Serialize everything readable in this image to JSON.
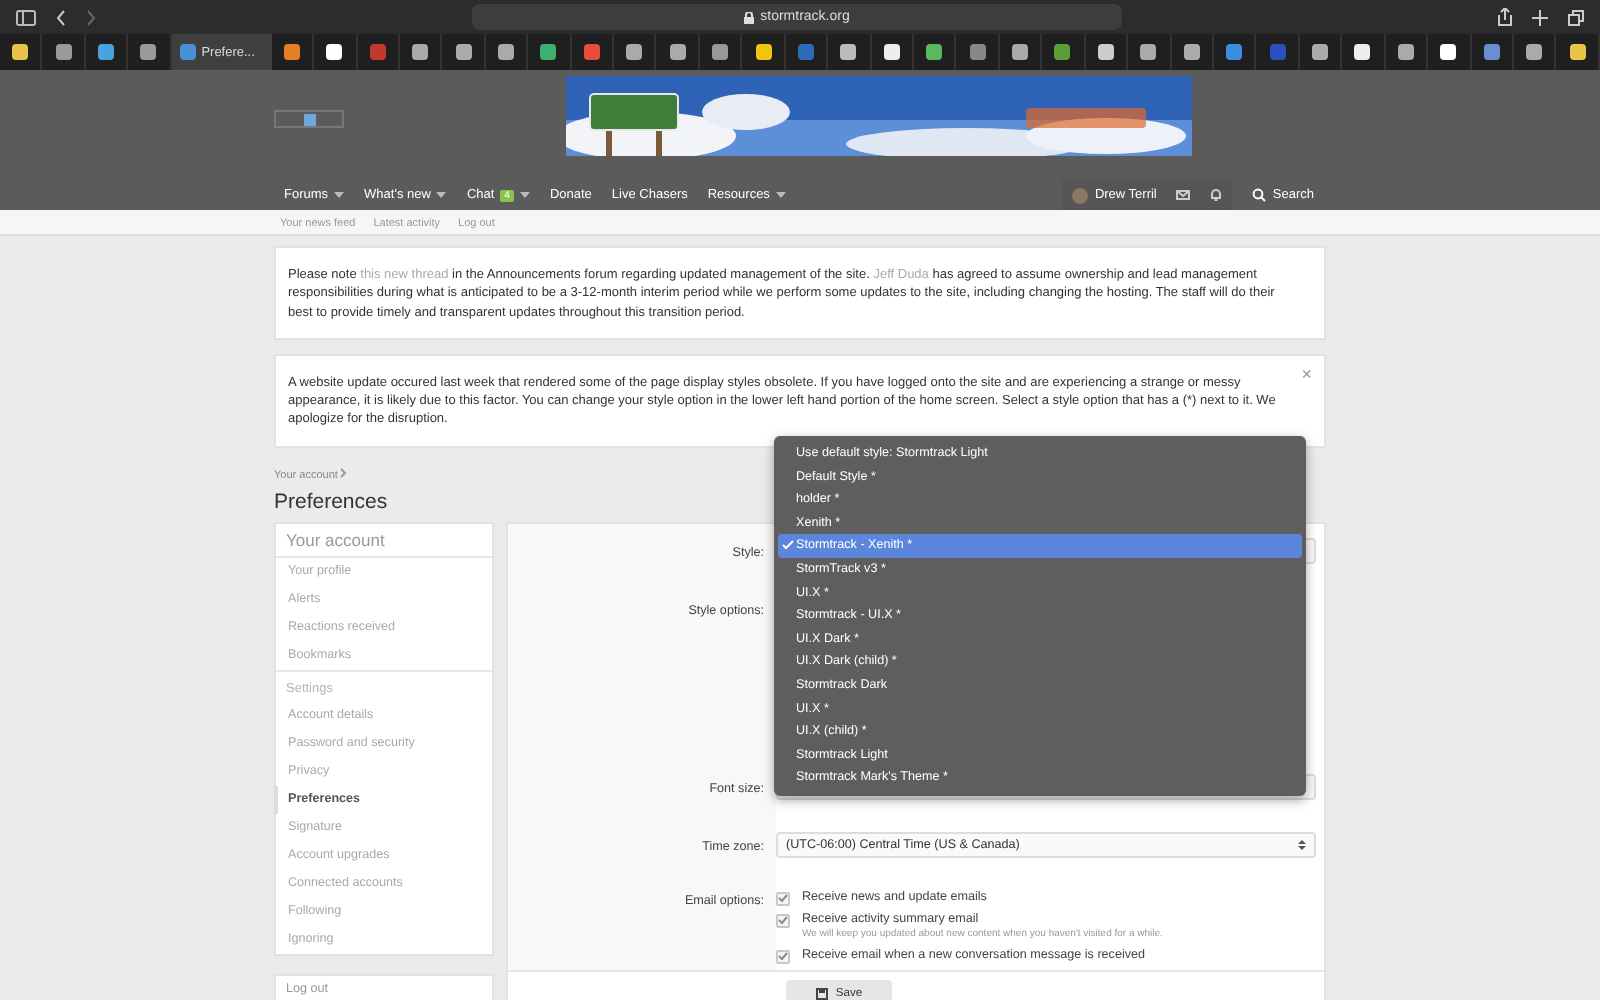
{
  "browser": {
    "url": "stormtrack.org",
    "tabs": [
      {
        "kind": "icon",
        "selected": false
      },
      {
        "kind": "icon",
        "selected": false
      },
      {
        "kind": "icon",
        "selected": false
      },
      {
        "kind": "icon",
        "selected": false
      },
      {
        "kind": "page",
        "label": "Prefere...",
        "selected": true
      },
      {
        "kind": "icon",
        "selected": false
      },
      {
        "kind": "icon",
        "selected": false
      },
      {
        "kind": "icon",
        "selected": false
      },
      {
        "kind": "icon",
        "selected": false
      },
      {
        "kind": "icon",
        "selected": false
      },
      {
        "kind": "icon",
        "selected": false
      },
      {
        "kind": "icon",
        "selected": false
      },
      {
        "kind": "icon",
        "selected": false
      },
      {
        "kind": "icon",
        "selected": false
      },
      {
        "kind": "icon",
        "selected": false
      },
      {
        "kind": "icon",
        "selected": false
      },
      {
        "kind": "icon",
        "selected": false
      },
      {
        "kind": "icon",
        "selected": false
      },
      {
        "kind": "icon",
        "selected": false
      },
      {
        "kind": "icon",
        "selected": false
      },
      {
        "kind": "icon",
        "selected": false
      },
      {
        "kind": "icon",
        "selected": false
      },
      {
        "kind": "icon",
        "selected": false
      },
      {
        "kind": "icon",
        "selected": false
      },
      {
        "kind": "icon",
        "selected": false
      },
      {
        "kind": "icon",
        "selected": false
      },
      {
        "kind": "icon",
        "selected": false
      },
      {
        "kind": "icon",
        "selected": false
      },
      {
        "kind": "icon",
        "selected": false
      },
      {
        "kind": "icon",
        "selected": false
      },
      {
        "kind": "icon",
        "selected": false
      },
      {
        "kind": "icon",
        "selected": false
      },
      {
        "kind": "icon",
        "selected": false
      },
      {
        "kind": "icon",
        "selected": false
      },
      {
        "kind": "icon",
        "selected": false
      },
      {
        "kind": "icon",
        "selected": false
      }
    ]
  },
  "nav": {
    "items": [
      {
        "label": "Forums",
        "dropdown": true
      },
      {
        "label": "What's new",
        "dropdown": true
      },
      {
        "label": "Chat",
        "badge": "4",
        "dropdown": true
      },
      {
        "label": "Donate",
        "dropdown": false
      },
      {
        "label": "Live Chasers",
        "dropdown": false
      },
      {
        "label": "Resources",
        "dropdown": true
      }
    ],
    "user": "Drew Terril",
    "search": "Search"
  },
  "subnav": [
    "Your news feed",
    "Latest activity",
    "Log out"
  ],
  "notices": [
    {
      "parts": [
        {
          "text": "Please note ",
          "link": false
        },
        {
          "text": "this new thread",
          "link": true
        },
        {
          "text": " in the Announcements forum regarding updated management of the site. ",
          "link": false
        },
        {
          "text": "Jeff Duda",
          "link": true
        },
        {
          "text": " has agreed to assume ownership and lead management responsibilities during what is anticipated to be a 3-12-month interim period while we perform some updates to the site, including changing the hosting. The staff will do their best to provide timely and transparent updates throughout this transition period.",
          "link": false
        }
      ]
    },
    {
      "close": "×",
      "parts": [
        {
          "text": "A website update occured last week that rendered some of the page display styles obsolete. If you have logged onto the site and are experiencing a strange or messy appearance, it is likely due to this factor. You can change your style option in the lower left hand portion of the home screen. Select a style option that has a (*) next to it. We apologize for the disruption.",
          "link": false
        }
      ]
    }
  ],
  "breadcrumb": "Your account",
  "title": "Preferences",
  "sidebar": {
    "sections": [
      {
        "heading": "Your account",
        "kind": "main",
        "items": [
          {
            "label": "Your profile",
            "selected": false
          },
          {
            "label": "Alerts",
            "selected": false
          },
          {
            "label": "Reactions received",
            "selected": false
          },
          {
            "label": "Bookmarks",
            "selected": false
          }
        ]
      },
      {
        "heading": "Settings",
        "kind": "sub",
        "items": [
          {
            "label": "Account details",
            "selected": false
          },
          {
            "label": "Password and security",
            "selected": false
          },
          {
            "label": "Privacy",
            "selected": false
          },
          {
            "label": "Preferences",
            "selected": true
          },
          {
            "label": "Signature",
            "selected": false
          },
          {
            "label": "Account upgrades",
            "selected": false
          },
          {
            "label": "Connected accounts",
            "selected": false
          },
          {
            "label": "Following",
            "selected": false
          },
          {
            "label": "Ignoring",
            "selected": false
          }
        ]
      }
    ],
    "logout": "Log out"
  },
  "form": {
    "rows": [
      {
        "kind": "select",
        "label": "Style:"
      },
      {
        "kind": "options",
        "label": "Style options:"
      },
      {
        "kind": "select",
        "label": "Font size:"
      },
      {
        "kind": "select",
        "label": "Time zone:",
        "value": "(UTC-06:00) Central Time (US & Canada)"
      },
      {
        "kind": "checkboxes",
        "label": "Email options:",
        "options": [
          {
            "label": "Receive news and update emails",
            "checked": true
          },
          {
            "label": "Receive activity summary email",
            "checked": true,
            "hint": "We will keep you updated about new content when you haven't visited for a while."
          },
          {
            "label": "Receive email when a new conversation message is received",
            "checked": true
          }
        ]
      }
    ],
    "save": "Save"
  },
  "dropdown": {
    "options": [
      {
        "label": "Use default style: Stormtrack Light",
        "selected": false
      },
      {
        "label": "Default Style *",
        "selected": false
      },
      {
        "label": "holder *",
        "selected": false
      },
      {
        "label": "Xenith *",
        "selected": false
      },
      {
        "label": "Stormtrack - Xenith *",
        "selected": true
      },
      {
        "label": "StormTrack v3 *",
        "selected": false
      },
      {
        "label": "UI.X *",
        "selected": false
      },
      {
        "label": "Stormtrack - UI.X *",
        "selected": false
      },
      {
        "label": "UI.X Dark *",
        "selected": false
      },
      {
        "label": "UI.X Dark (child) *",
        "selected": false
      },
      {
        "label": "Stormtrack Dark",
        "selected": false
      },
      {
        "label": "UI.X *",
        "selected": false
      },
      {
        "label": "UI.X (child) *",
        "selected": false
      },
      {
        "label": "Stormtrack Light",
        "selected": false
      },
      {
        "label": "Stormtrack Mark's Theme *",
        "selected": false
      }
    ]
  }
}
